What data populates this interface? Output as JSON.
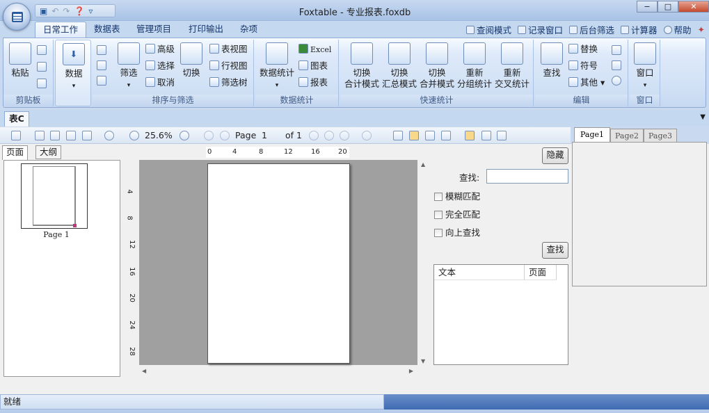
{
  "window": {
    "title": "Foxtable - 专业报表.foxdb",
    "controls": [
      "−",
      "□",
      "✕"
    ]
  },
  "quick_access": [
    "save-icon",
    "undo-icon",
    "redo-icon",
    "help-icon",
    "customize-icon"
  ],
  "ribbon_tabs": [
    "日常工作",
    "数据表",
    "管理项目",
    "打印输出",
    "杂项"
  ],
  "right_tools": [
    "查阅模式",
    "记录窗口",
    "后台筛选",
    "计算器",
    "帮助"
  ],
  "groups": {
    "clipboard": {
      "label": "剪贴板",
      "paste": "粘贴"
    },
    "data": {
      "label": "",
      "data_btn": "数据"
    },
    "sort_filter": {
      "label": "排序与筛选",
      "filter": "筛选",
      "advanced": "高级",
      "select": "选择",
      "cancel": "取消",
      "toggle": "切换",
      "table_view": "表视图",
      "row_view": "行视图",
      "filter_tree": "筛选树"
    },
    "stats": {
      "label": "数据统计",
      "data_stats": "数据统计",
      "excel": "Excel",
      "chart": "图表",
      "report": "报表"
    },
    "quick_stats": {
      "label": "快速统计",
      "b1": [
        "切换",
        "合计模式"
      ],
      "b2": [
        "切换",
        "汇总模式"
      ],
      "b3": [
        "切换",
        "合并模式"
      ],
      "b4": [
        "重新",
        "分组统计"
      ],
      "b5": [
        "重新",
        "交叉统计"
      ]
    },
    "edit": {
      "label": "编辑",
      "find": "查找",
      "replace": "替换",
      "symbol": "符号",
      "other": "其他"
    },
    "window": {
      "label": "窗口",
      "window_btn": "窗口"
    }
  },
  "doc_tab": "表C",
  "toolbar": {
    "zoom": "25.6%",
    "page_label": "Page",
    "page_value": "1",
    "page_total": "of 1"
  },
  "nav": {
    "tab_pages": "页面",
    "tab_outline": "大纲",
    "thumb_label": "Page 1"
  },
  "hruler_ticks": [
    "0",
    "4",
    "8",
    "12",
    "16",
    "20"
  ],
  "vruler_ticks": [
    "4",
    "8",
    "12",
    "16",
    "20",
    "24",
    "28"
  ],
  "search": {
    "hide": "隐藏",
    "find_label": "查找:",
    "find_value": "",
    "fuzzy": "模糊匹配",
    "exact": "完全匹配",
    "up": "向上查找",
    "find_btn": "查找",
    "col_text": "文本",
    "col_page": "页面"
  },
  "page_tabs": [
    "Page1",
    "Page2",
    "Page3"
  ],
  "status": "就绪"
}
